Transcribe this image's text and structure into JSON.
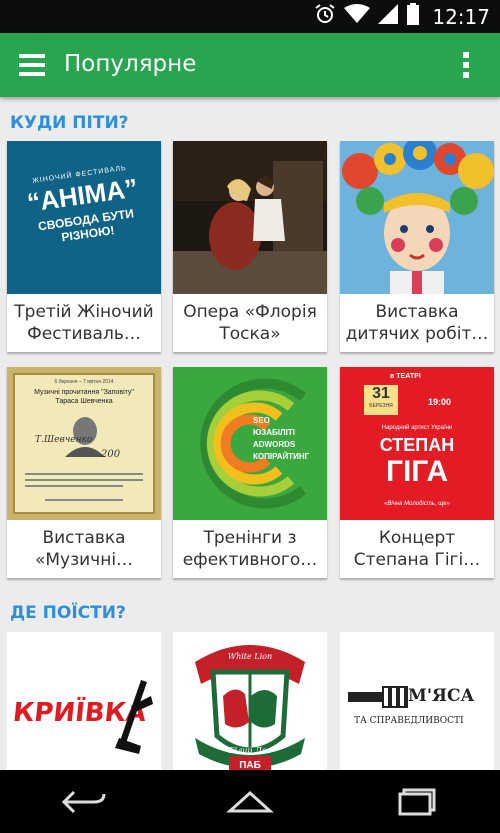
{
  "status_bar": {
    "time": "12:17"
  },
  "app_bar": {
    "title": "Популярне"
  },
  "sections": [
    {
      "title": "КУДИ ПІТИ?"
    },
    {
      "title": "ДЕ ПОЇСТИ?"
    }
  ],
  "cards": [
    {
      "line1": "Третій Жіночий",
      "line2": "Фестиваль…",
      "poster": {
        "top": "ЖІНОЧИЙ ФЕСТИВАЛЬ",
        "name": "“АНІМА”",
        "slogan1": "СВОБОДА БУТИ",
        "slogan2": "РІЗНОЮ!"
      }
    },
    {
      "line1": "Опера «Флорія",
      "line2": "Тоска»"
    },
    {
      "line1": "Виставка",
      "line2": "дитячих робіт…"
    },
    {
      "line1": "Виставка",
      "line2": "«Музичні…",
      "poster": {
        "date": "6 березня – 7 квітня 2014",
        "head1": "Музичні прочитання \"Заповіту\"",
        "head2": "Тараса Шевченка",
        "sign": "Т.Шевченко",
        "year": "200"
      }
    },
    {
      "line1": "Тренінги з",
      "line2": "ефективного…",
      "poster": {
        "l1": "SEO",
        "l2": "ЮЗАБІЛІТІ",
        "l3": "ADWORDS",
        "l4": "КОПІРАЙТИНГ"
      }
    },
    {
      "line1": "Концерт",
      "line2": "Степана Гігі…",
      "poster": {
        "venue": "в ТЕАТРІ",
        "day": "31",
        "month": "БЕРЕЗНЯ",
        "hour": "19:00",
        "title": "Народний артист України",
        "name1": "СТЕПАН",
        "name2": "ГІГА",
        "motto": "«Вічна Молодість, ще»"
      }
    }
  ],
  "restaurants": [
    {
      "name": "КРИЇВКА"
    },
    {
      "top": "White Lion",
      "bottom1": "Білий Лев",
      "bottom2": "ПАБ"
    },
    {
      "name": "М'ЯСА",
      "sub": "ТА СПРАВЕДЛИВОСТІ"
    }
  ],
  "colors": {
    "app_bar": "#27a54f",
    "status_bar": "#0d0d0d",
    "section_title": "#2f8fdc",
    "background": "#ececec"
  },
  "icons": [
    "alarm-icon",
    "wifi-icon",
    "signal-icon",
    "battery-icon",
    "hamburger-icon",
    "more-vert-icon",
    "back-icon",
    "home-icon",
    "recents-icon"
  ]
}
